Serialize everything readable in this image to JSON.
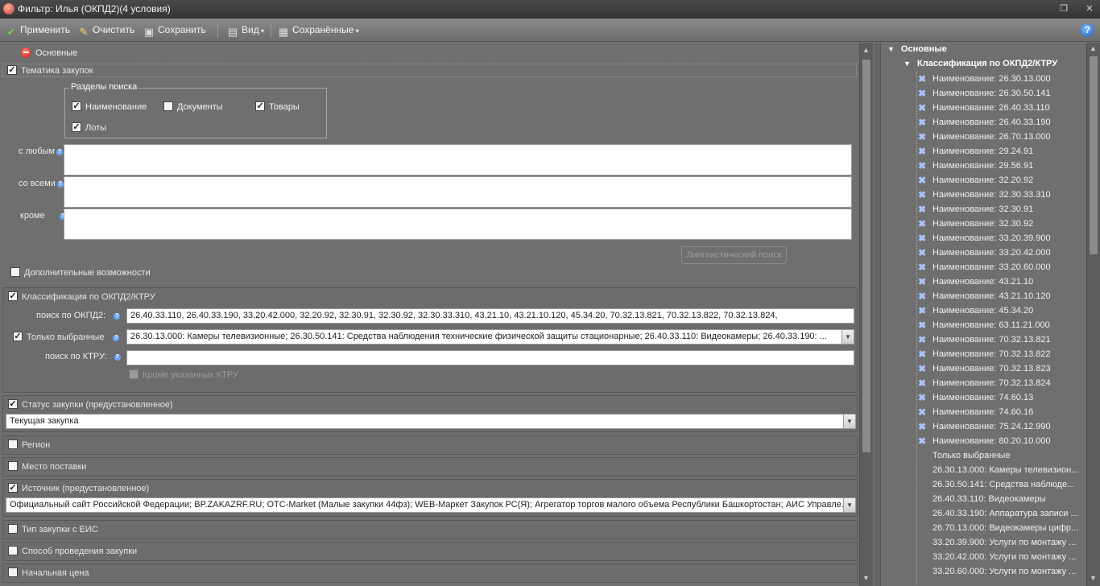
{
  "window": {
    "title": "Фильтр: Илья (ОКПД2)(4 условия)"
  },
  "toolbar": {
    "apply": "Применить",
    "clear": "Очистить",
    "save": "Сохранить",
    "view": "Вид",
    "saved": "Сохранённые"
  },
  "main": {
    "basic_label": "Основные",
    "topic": {
      "header": "Тематика закупок",
      "search_sections_legend": "Разделы поиска",
      "opt_name": "Наименование",
      "opt_documents": "Документы",
      "opt_goods": "Товары",
      "opt_lots": "Лоты",
      "any_label": "с любым",
      "all_label": "со всеми",
      "except_label": "кроме",
      "ling_button": "Лингвистический поиск",
      "extra_label": "Дополнительные возможности"
    },
    "okpd": {
      "header": "Классификация по ОКПД2/КТРУ",
      "search_okpd_label": "поиск по ОКПД2:",
      "search_okpd_value": "26.40.33.110, 26.40.33.190, 33.20.42.000, 32.20.92, 32.30.91, 32.30.92, 32.30.33.310, 43.21.10, 43.21.10.120, 45.34.20, 70.32.13.821, 70.32.13.822, 70.32.13.824,",
      "only_selected_label": "Только выбранные",
      "only_selected_value": "26.30.13.000: Камеры телевизионные; 26.30.50.141: Средства наблюдения технические физической защиты стационарные; 26.40.33.110: Видеокамеры; 26.40.33.190: ...",
      "search_ktru_label": "поиск по КТРУ:",
      "search_ktru_value": "",
      "except_ktru_label": "Кроме указанных КТРУ"
    },
    "status": {
      "header": "Статус закупки (предустановленное)",
      "value": "Текущая закупка"
    },
    "region": {
      "header": "Регион"
    },
    "delivery": {
      "header": "Место поставки"
    },
    "source": {
      "header": "Источник (предустановленное)",
      "value": "Официальный сайт Российской Федерации; BP.ZAKAZRF.RU; OTC-Market (Малые закупки 44фз); WEB-Маркет Закупок РС(Я); Агрегатор торгов малого объема Республики Башкортостан; АИС Управле..."
    },
    "eis_type": {
      "header": "Тип закупки с ЕИС"
    },
    "method": {
      "header": "Способ проведения закупки"
    },
    "price": {
      "header": "Начальная цена"
    }
  },
  "tree": {
    "root": "Основные",
    "sub": "Классификация по ОКПД2/КТРУ",
    "items": [
      "Наименование: 26.30.13.000",
      "Наименование: 26.30.50.141",
      "Наименование: 26.40.33.110",
      "Наименование: 26.40.33.190",
      "Наименование: 26.70.13.000",
      "Наименование: 29.24.91",
      "Наименование: 29.56.91",
      "Наименование: 32.20.92",
      "Наименование: 32.30.33.310",
      "Наименование: 32.30.91",
      "Наименование: 32.30.92",
      "Наименование: 33.20.39.900",
      "Наименование: 33.20.42.000",
      "Наименование: 33.20.60.000",
      "Наименование: 43.21.10",
      "Наименование: 43.21.10.120",
      "Наименование: 45.34.20",
      "Наименование: 63.11.21.000",
      "Наименование: 70.32.13.821",
      "Наименование: 70.32.13.822",
      "Наименование: 70.32.13.823",
      "Наименование: 70.32.13.824",
      "Наименование: 74.60.13",
      "Наименование: 74.60.16",
      "Наименование: 75.24.12.990",
      "Наименование: 80.20.10.000"
    ],
    "only_selected": "Только выбранные",
    "selected_items": [
      "26.30.13.000: Камеры телевизион...",
      "26.30.50.141: Средства наблюде...",
      "26.40.33.110: Видеокамеры",
      "26.40.33.190: Аппаратура записи ...",
      "26.70.13.000: Видеокамеры цифр...",
      "33.20.39.900: Услуги по монтажу ...",
      "33.20.42.000: Услуги по монтажу ...",
      "33.20.60.000: Услуги по монтажу ..."
    ]
  }
}
